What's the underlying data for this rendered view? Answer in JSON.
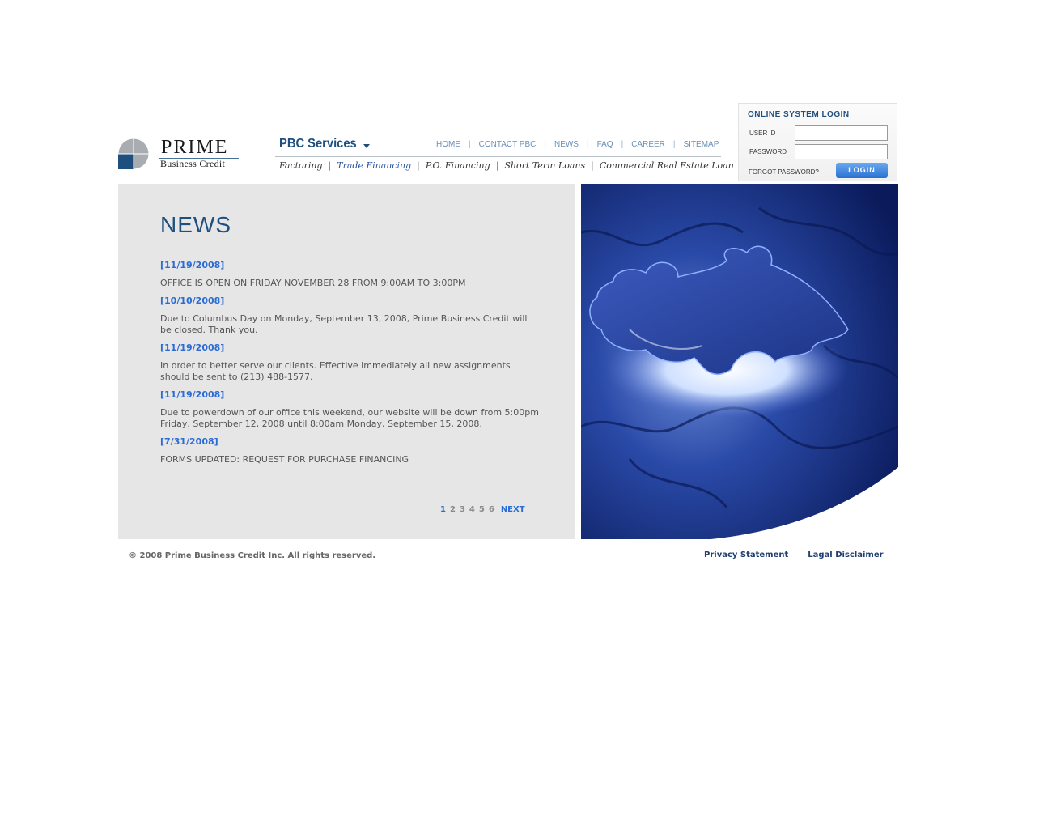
{
  "logo": {
    "name": "PRIME",
    "sub": "Business Credit"
  },
  "services_menu": {
    "label": "PBC Services"
  },
  "top_nav": [
    {
      "label": "HOME"
    },
    {
      "label": "CONTACT PBC"
    },
    {
      "label": "NEWS"
    },
    {
      "label": "FAQ"
    },
    {
      "label": "CAREER"
    },
    {
      "label": "SITEMAP"
    }
  ],
  "service_nav": [
    {
      "label": "Factoring",
      "active": false
    },
    {
      "label": "Trade Financing",
      "active": true
    },
    {
      "label": "P.O. Financing",
      "active": false
    },
    {
      "label": "Short Term Loans",
      "active": false
    },
    {
      "label": "Commercial Real Estate Loan",
      "active": false
    }
  ],
  "login": {
    "title": "ONLINE SYSTEM LOGIN",
    "userid_label": "USER ID",
    "userid_value": "",
    "password_label": "PASSWORD",
    "password_value": "",
    "forgot": "FORGOT PASSWORD?",
    "button": "LOGIN"
  },
  "news": {
    "title": "NEWS",
    "items": [
      {
        "date": "[11/19/2008]",
        "text": "OFFICE IS OPEN ON FRIDAY NOVEMBER 28 FROM 9:00AM TO 3:00PM"
      },
      {
        "date": "[10/10/2008]",
        "text": "Due to Columbus Day on Monday, September 13, 2008, Prime Business Credit will be closed. Thank you."
      },
      {
        "date": "[11/19/2008]",
        "text": "In order to better serve our clients. Effective immediately all new assignments should be sent to (213) 488-1577."
      },
      {
        "date": "[11/19/2008]",
        "text": "Due to powerdown of our office this weekend, our website will be down from 5:00pm Friday, September 12, 2008 until 8:00am Monday, September 15, 2008."
      },
      {
        "date": "[7/31/2008]",
        "text": "FORMS UPDATED: REQUEST FOR PURCHASE FINANCING"
      }
    ],
    "pager": {
      "pages": [
        "1",
        "2",
        "3",
        "4",
        "5",
        "6"
      ],
      "current": "1",
      "next": "NEXT"
    }
  },
  "footer": {
    "copyright": "© 2008 Prime Business Credit Inc. All rights reserved.",
    "privacy": "Privacy Statement",
    "disclaimer": "Lagal Disclaimer"
  },
  "colors": {
    "brand_blue": "#1f4f7f",
    "link_blue": "#2a6bd4",
    "panel_gray": "#e6e6e6"
  }
}
